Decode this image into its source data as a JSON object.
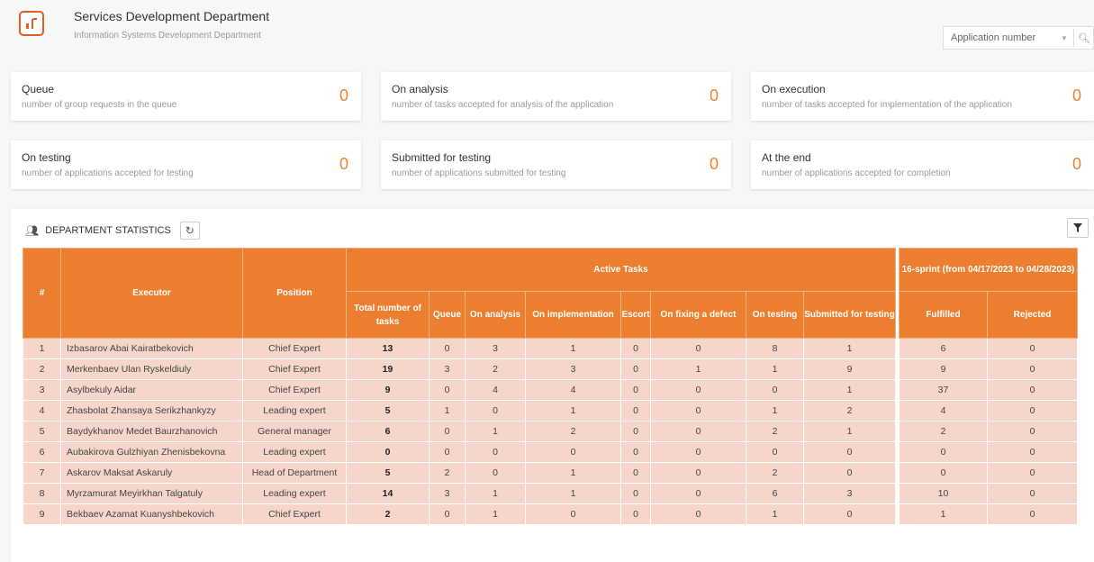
{
  "header": {
    "title": "Services Development Department",
    "subtitle": "Information Systems Development Department",
    "search": {
      "placeholder": "Application number"
    }
  },
  "cards": [
    {
      "title": "Queue",
      "desc": "number of group requests in the queue",
      "value": "0"
    },
    {
      "title": "On analysis",
      "desc": "number of tasks accepted for analysis of the application",
      "value": "0"
    },
    {
      "title": "On execution",
      "desc": "number of tasks accepted for implementation of the application",
      "value": "0"
    },
    {
      "title": "On testing",
      "desc": "number of applications accepted for testing",
      "value": "0"
    },
    {
      "title": "Submitted for testing",
      "desc": "number of applications submitted for testing",
      "value": "0"
    },
    {
      "title": "At the end",
      "desc": "number of applications accepted for completion",
      "value": "0"
    }
  ],
  "stats": {
    "title": "DEPARTMENT STATISTICS",
    "headers": {
      "num": "#",
      "executor": "Executor",
      "position": "Position",
      "active": "Active Tasks",
      "sprint": "16-sprint (from 04/17/2023 to 04/28/2023)",
      "total": "Total number of tasks",
      "queue": "Queue",
      "analysis": "On analysis",
      "implementation": "On implementation",
      "escort": "Escort",
      "fixing": "On fixing a defect",
      "testing": "On testing",
      "submitted": "Submitted for testing",
      "fulfilled": "Fulfilled",
      "rejected": "Rejected"
    },
    "rows": [
      [
        "1",
        "Izbasarov Abai Kairatbekovich",
        "Chief Expert",
        "13",
        "0",
        "3",
        "1",
        "0",
        "0",
        "8",
        "1",
        "6",
        "0"
      ],
      [
        "2",
        "Merkenbaev Ulan Ryskeldiuly",
        "Chief Expert",
        "19",
        "3",
        "2",
        "3",
        "0",
        "1",
        "1",
        "9",
        "9",
        "0"
      ],
      [
        "3",
        "Asylbekuly Aidar",
        "Chief Expert",
        "9",
        "0",
        "4",
        "4",
        "0",
        "0",
        "0",
        "1",
        "37",
        "0"
      ],
      [
        "4",
        "Zhasbolat Zhansaya Serikzhankyzy",
        "Leading expert",
        "5",
        "1",
        "0",
        "1",
        "0",
        "0",
        "1",
        "2",
        "4",
        "0"
      ],
      [
        "5",
        "Baydykhanov Medet Baurzhanovich",
        "General manager",
        "6",
        "0",
        "1",
        "2",
        "0",
        "0",
        "2",
        "1",
        "2",
        "0"
      ],
      [
        "6",
        "Aubakirova Gulzhiyan Zhenisbekovna",
        "Leading expert",
        "0",
        "0",
        "0",
        "0",
        "0",
        "0",
        "0",
        "0",
        "0",
        "0"
      ],
      [
        "7",
        "Askarov Maksat Askaruly",
        "Head of Department",
        "5",
        "2",
        "0",
        "1",
        "0",
        "0",
        "2",
        "0",
        "0",
        "0"
      ],
      [
        "8",
        "Myrzamurat Meyirkhan Talgatuly",
        "Leading expert",
        "14",
        "3",
        "1",
        "1",
        "0",
        "0",
        "6",
        "3",
        "10",
        "0"
      ],
      [
        "9",
        "Bekbaev Azamat Kuanyshbekovich",
        "Chief Expert",
        "2",
        "0",
        "1",
        "0",
        "0",
        "0",
        "1",
        "0",
        "1",
        "0"
      ]
    ]
  }
}
